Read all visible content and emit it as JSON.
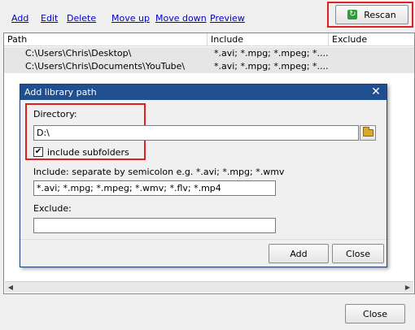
{
  "toolbar": {
    "add": "Add",
    "edit": "Edit",
    "delete": "Delete",
    "move_up": "Move up",
    "move_down": "Move down",
    "preview": "Preview",
    "rescan": "Rescan",
    "rescan_icon": "refresh-icon"
  },
  "list": {
    "columns": [
      "Path",
      "Include",
      "Exclude"
    ],
    "rows": [
      {
        "path": "C:\\Users\\Chris\\Desktop\\",
        "include": "*.avi; *.mpg; *.mpeg; *...."
      },
      {
        "path": "C:\\Users\\Chris\\Documents\\YouTube\\",
        "include": "*.avi; *.mpg; *.mpeg; *...."
      }
    ]
  },
  "dialog": {
    "title": "Add library path",
    "close_glyph": "✕",
    "directory_label": "Directory:",
    "directory_value": "D:\\",
    "include_subfolders_label": "include subfolders",
    "include_subfolders_checked": true,
    "include_label": "Include:  separate by semicolon e.g. *.avi; *.mpg; *.wmv",
    "include_value": "*.avi; *.mpg; *.mpeg; *.wmv; *.flv; *.mp4",
    "exclude_label": "Exclude:",
    "exclude_value": "",
    "add_button": "Add",
    "close_button": "Close"
  },
  "footer": {
    "close_button": "Close"
  },
  "colors": {
    "link": "#0000cc",
    "highlight": "#e02020",
    "dialog_title": "#1f4f8e"
  }
}
